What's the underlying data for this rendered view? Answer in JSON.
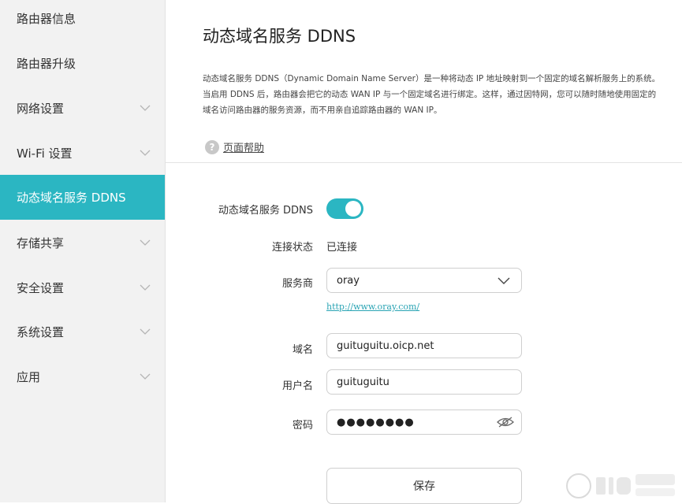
{
  "sidebar": {
    "items": [
      {
        "label": "路由器信息",
        "has_chevron": false,
        "active": false
      },
      {
        "label": "路由器升级",
        "has_chevron": false,
        "active": false
      },
      {
        "label": "网络设置",
        "has_chevron": true,
        "active": false
      },
      {
        "label": "Wi-Fi 设置",
        "has_chevron": true,
        "active": false
      },
      {
        "label": "动态域名服务 DDNS",
        "has_chevron": false,
        "active": true
      },
      {
        "label": "存储共享",
        "has_chevron": true,
        "active": false
      },
      {
        "label": "安全设置",
        "has_chevron": true,
        "active": false
      },
      {
        "label": "系统设置",
        "has_chevron": true,
        "active": false
      },
      {
        "label": "应用",
        "has_chevron": true,
        "active": false
      }
    ]
  },
  "main": {
    "title": "动态域名服务 DDNS",
    "description_lines": [
      "动态域名服务 DDNS（Dynamic Domain Name Server）是一种将动态 IP 地址映射到一个固定的域名解析服务上的系统。",
      "当启用 DDNS 后，路由器会把它的动态 WAN IP 与一个固定域名进行绑定。这样，通过因特网，您可以随时随地使用固定的",
      "域名访问路由器的服务资源，而不用亲自追踪路由器的 WAN IP。"
    ],
    "help_icon": "question-circle-icon",
    "help_link": "页面帮助"
  },
  "form": {
    "ddns_label": "动态域名服务 DDNS",
    "ddns_enabled": true,
    "status_label": "连接状态",
    "status_value": "已连接",
    "provider_label": "服务商",
    "provider_value": "oray",
    "provider_url": "http://www.oray.com/",
    "domain_label": "域名",
    "domain_value": "guituguitu.oicp.net",
    "username_label": "用户名",
    "username_value": "guituguitu",
    "password_label": "密码",
    "password_masked": "●●●●●●●●",
    "save_label": "保存"
  },
  "colors": {
    "accent": "#2bb6c2",
    "sidebar_bg": "#f2f2f2"
  }
}
